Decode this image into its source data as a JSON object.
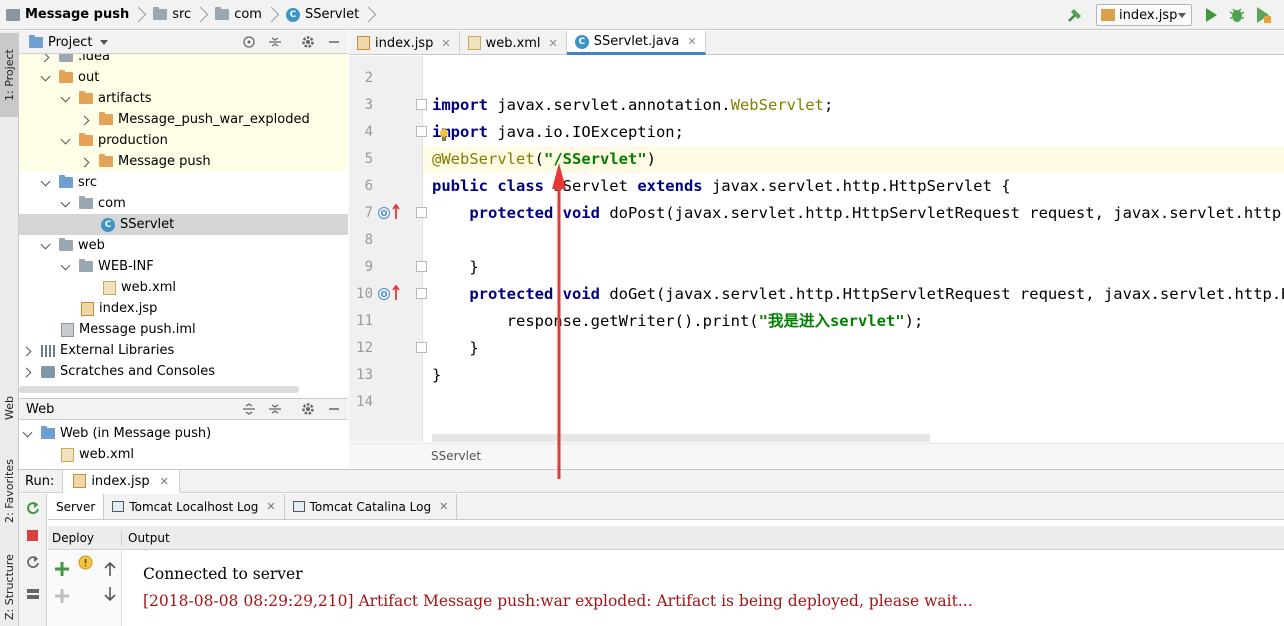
{
  "navbar": {
    "breadcrumbs": [
      "Message push",
      "src",
      "com",
      "SServlet"
    ],
    "run_config": "index.jsp"
  },
  "left_strip": {
    "project_tab": "1: Project",
    "web_tab": "Web",
    "favorites_tab": "2: Favorites",
    "structure_tab": "Z: Structure"
  },
  "project_panel": {
    "title": "Project",
    "tree": [
      {
        "label": ".idea",
        "level": 1
      },
      {
        "label": "out",
        "level": 1
      },
      {
        "label": "artifacts",
        "level": 2
      },
      {
        "label": "Message_push_war_exploded",
        "level": 3
      },
      {
        "label": "production",
        "level": 2
      },
      {
        "label": "Message push",
        "level": 3
      },
      {
        "label": "src",
        "level": 1
      },
      {
        "label": "com",
        "level": 2
      },
      {
        "label": "SServlet",
        "level": 3
      },
      {
        "label": "web",
        "level": 1
      },
      {
        "label": "WEB-INF",
        "level": 2
      },
      {
        "label": "web.xml",
        "level": 3
      },
      {
        "label": "index.jsp",
        "level": 2
      },
      {
        "label": "Message push.iml",
        "level": 1
      },
      {
        "label": "External Libraries",
        "level": 0
      },
      {
        "label": "Scratches and Consoles",
        "level": 0
      }
    ]
  },
  "web_panel": {
    "title": "Web",
    "tree": [
      {
        "label": "Web (in Message push)"
      },
      {
        "label": "web.xml"
      }
    ]
  },
  "editor": {
    "tabs": [
      {
        "label": "index.jsp"
      },
      {
        "label": "web.xml"
      },
      {
        "label": "SServlet.java",
        "active": true
      }
    ],
    "line_numbers": [
      "2",
      "3",
      "4",
      "5",
      "6",
      "7",
      "8",
      "9",
      "10",
      "11",
      "12",
      "13",
      "14"
    ],
    "lines": {
      "l3_kw": "import",
      "l3_rest": " javax.servlet.annotation.",
      "l3_ann": "WebServlet",
      "l3_end": ";",
      "l4_kw": "import",
      "l4_rest": " java.io.IOException;",
      "l5_ann": "@WebServlet",
      "l5_open": "(",
      "l5_str": "\"/SServlet\"",
      "l5_close": ")",
      "l6_kw1": "public class",
      "l6_mid": " SServlet ",
      "l6_kw2": "extends",
      "l6_rest": " javax.servlet.http.HttpServlet {",
      "l7_kw": "    protected void",
      "l7_rest": " doPost(javax.servlet.http.HttpServletRequest request, javax.servlet.http.Ht",
      "l9": "    }",
      "l10_kw": "    protected void",
      "l10_rest": " doGet(javax.servlet.http.HttpServletRequest request, javax.servlet.http.Htt",
      "l11_pre": "        response.getWriter().print(",
      "l11_str": "\"我是进入servlet\"",
      "l11_end": ");",
      "l12": "    }",
      "l13": "}"
    },
    "breadcrumb": "SServlet"
  },
  "run_panel": {
    "label": "Run:",
    "tab": "index.jsp",
    "server_tabs": [
      {
        "label": "Server"
      },
      {
        "label": "Tomcat Localhost Log"
      },
      {
        "label": "Tomcat Catalina Log"
      }
    ],
    "deploy_header": "Deploy",
    "output_header": "Output",
    "output_lines": [
      "Connected to server",
      "[2018-08-08 08:29:29,210] Artifact Message push:war exploded: Artifact is being deployed, please wait..."
    ]
  },
  "colors": {
    "keyword": "#000080",
    "annotation": "#808000",
    "string": "#008000",
    "error_text": "#a31515",
    "arrow": "#e53935"
  }
}
